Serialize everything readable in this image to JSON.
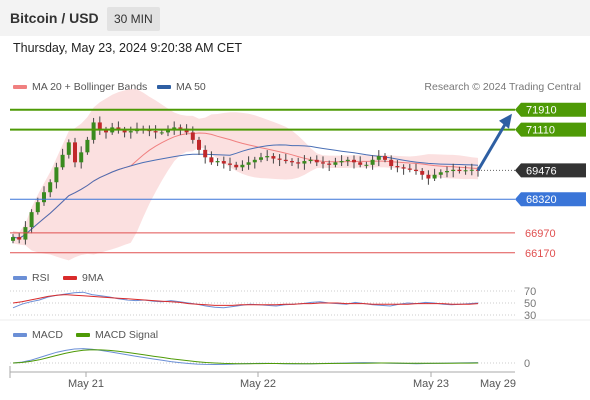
{
  "header": {
    "title": "Bitcoin / USD",
    "interval": "30 MIN"
  },
  "datetime": "Thursday, May 23, 2024 9:20:38 AM CET",
  "legend": {
    "ma20_label": "MA 20 + Bollinger Bands",
    "ma50_label": "MA 50",
    "credit": "Research © 2024 Trading Central"
  },
  "colors": {
    "resistance": "#4e9a06",
    "support": "#3a75d8",
    "lower_support": "#e05050",
    "current": "#333333",
    "ma20": "#f08080",
    "ma50": "#4a6fb5",
    "rsi": "#6b8fd6",
    "rsi_ma": "#d92b2b",
    "macd": "#6b8fd6",
    "macd_signal": "#4e9a06",
    "arrow": "#2e5fa3"
  },
  "chart_data": [
    {
      "type": "candlestick",
      "x_ticks": [
        "May 21",
        "May 22",
        "May 23",
        "May 29"
      ],
      "ylim": [
        65800,
        72300
      ],
      "current_price": 69476,
      "levels": [
        {
          "value": 71910,
          "label": "71910",
          "kind": "resistance"
        },
        {
          "value": 71110,
          "label": "71110",
          "kind": "resistance"
        },
        {
          "value": 69476,
          "label": "69476",
          "kind": "current"
        },
        {
          "value": 68320,
          "label": "68320",
          "kind": "support"
        },
        {
          "value": 66970,
          "label": "66970",
          "kind": "lower"
        },
        {
          "value": 66170,
          "label": "66170",
          "kind": "lower"
        }
      ],
      "close_path": [
        66800,
        66700,
        67200,
        67800,
        68200,
        68600,
        69000,
        69600,
        70100,
        70600,
        69800,
        70200,
        70700,
        71400,
        71100,
        71000,
        71200,
        71100,
        71000,
        71050,
        71150,
        71100,
        71050,
        71000,
        71000,
        71100,
        71200,
        71150,
        71000,
        70700,
        70300,
        70000,
        69800,
        69850,
        69750,
        69700,
        69600,
        69700,
        69800,
        69900,
        70000,
        70050,
        69950,
        69900,
        69850,
        69800,
        69750,
        69850,
        69900,
        69800,
        69750,
        69700,
        69800,
        69850,
        69900,
        69800,
        69700,
        69700,
        69900,
        70050,
        69900,
        69650,
        69600,
        69550,
        69500,
        69450,
        69300,
        69150,
        69300,
        69400,
        69450,
        69500,
        69450,
        69480,
        69500,
        69476
      ],
      "arrow_target": 71910
    },
    {
      "type": "line",
      "name": "RSI",
      "legend": [
        "RSI",
        "9MA"
      ],
      "ticks": [
        "70",
        "50",
        "30"
      ],
      "ylim": [
        25,
        75
      ],
      "rsi": [
        42,
        48,
        52,
        55,
        60,
        63,
        65,
        67,
        68,
        64,
        62,
        60,
        57,
        55,
        54,
        55,
        53,
        52,
        54,
        52,
        50,
        48,
        45,
        43,
        42,
        44,
        46,
        48,
        47,
        46,
        45,
        47,
        48,
        49,
        51,
        52,
        50,
        49,
        48,
        51,
        49,
        47,
        46,
        45,
        48,
        50,
        49,
        51,
        50,
        48,
        47,
        48,
        49,
        50
      ],
      "rsi_ma": [
        50,
        52,
        55,
        58,
        61,
        63,
        64,
        63,
        62,
        61,
        60,
        59,
        58,
        57,
        56,
        55,
        54,
        53,
        52,
        51,
        49,
        48,
        47,
        46,
        46,
        46,
        47,
        47,
        47,
        47,
        47,
        48,
        48,
        49,
        49,
        50,
        50,
        50,
        49,
        49,
        49,
        48,
        48,
        48,
        48,
        48,
        49,
        49,
        49,
        49,
        48,
        48,
        48,
        49
      ]
    },
    {
      "type": "line",
      "name": "MACD",
      "legend": [
        "MACD",
        "MACD Signal"
      ],
      "ticks": [
        "0"
      ],
      "ylim": [
        -500,
        1000
      ],
      "macd": [
        0,
        50,
        150,
        300,
        450,
        600,
        700,
        780,
        800,
        760,
        700,
        620,
        540,
        460,
        380,
        300,
        220,
        150,
        80,
        20,
        -30,
        -60,
        -80,
        -85,
        -80,
        -60,
        -40,
        -30,
        -20,
        -25,
        -30,
        -40,
        -50,
        -45,
        -40,
        -30,
        -20,
        -10,
        0,
        10,
        20,
        10,
        0,
        -10,
        -20,
        -30,
        -40,
        -30,
        -20,
        -10,
        0,
        5,
        10,
        20
      ],
      "macd_signal": [
        0,
        30,
        90,
        180,
        300,
        420,
        540,
        640,
        710,
        740,
        730,
        700,
        650,
        590,
        520,
        450,
        380,
        310,
        240,
        180,
        120,
        70,
        30,
        0,
        -20,
        -35,
        -40,
        -40,
        -35,
        -30,
        -30,
        -32,
        -35,
        -38,
        -38,
        -35,
        -30,
        -25,
        -20,
        -15,
        -10,
        -5,
        0,
        0,
        -5,
        -10,
        -15,
        -18,
        -18,
        -15,
        -12,
        -8,
        -4,
        0
      ]
    }
  ]
}
